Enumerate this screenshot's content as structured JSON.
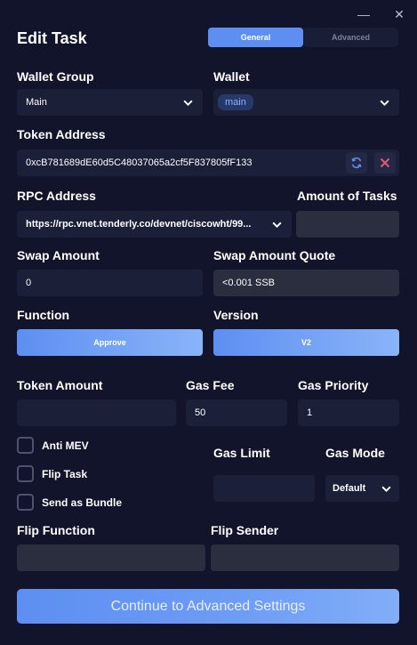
{
  "window": {
    "minimize": "—",
    "close": "✕"
  },
  "header": {
    "title": "Edit Task",
    "tabs": [
      "General",
      "Advanced"
    ]
  },
  "wallet_group": {
    "label": "Wallet Group",
    "value": "Main"
  },
  "wallet": {
    "label": "Wallet",
    "value": "main"
  },
  "token_address": {
    "label": "Token Address",
    "value": "0xcB781689dE60d5C48037065a2cf5F837805fF133"
  },
  "rpc_address": {
    "label": "RPC Address",
    "value": "https://rpc.vnet.tenderly.co/devnet/ciscowht/99..."
  },
  "amount_of_tasks": {
    "label": "Amount of Tasks",
    "value": ""
  },
  "swap_amount": {
    "label": "Swap Amount",
    "value": "0"
  },
  "swap_amount_quote": {
    "label": "Swap Amount Quote",
    "value": "<0.001 SSB"
  },
  "function": {
    "label": "Function",
    "value": "Approve"
  },
  "version": {
    "label": "Version",
    "value": "V2"
  },
  "token_amount": {
    "label": "Token Amount",
    "value": ""
  },
  "gas_fee": {
    "label": "Gas Fee",
    "value": "50"
  },
  "gas_priority": {
    "label": "Gas Priority",
    "value": "1"
  },
  "checkboxes": [
    "Anti MEV",
    "Flip Task",
    "Send as Bundle"
  ],
  "gas_limit": {
    "label": "Gas Limit",
    "value": ""
  },
  "gas_mode": {
    "label": "Gas Mode",
    "value": "Default"
  },
  "flip_function": {
    "label": "Flip Function",
    "value": ""
  },
  "flip_sender": {
    "label": "Flip Sender",
    "value": ""
  },
  "continue_button": "Continue to Advanced Settings",
  "colors": {
    "background": "#11142a",
    "field": "#1b1f37",
    "accent": "#5d8ff2",
    "danger": "#e0587a"
  }
}
